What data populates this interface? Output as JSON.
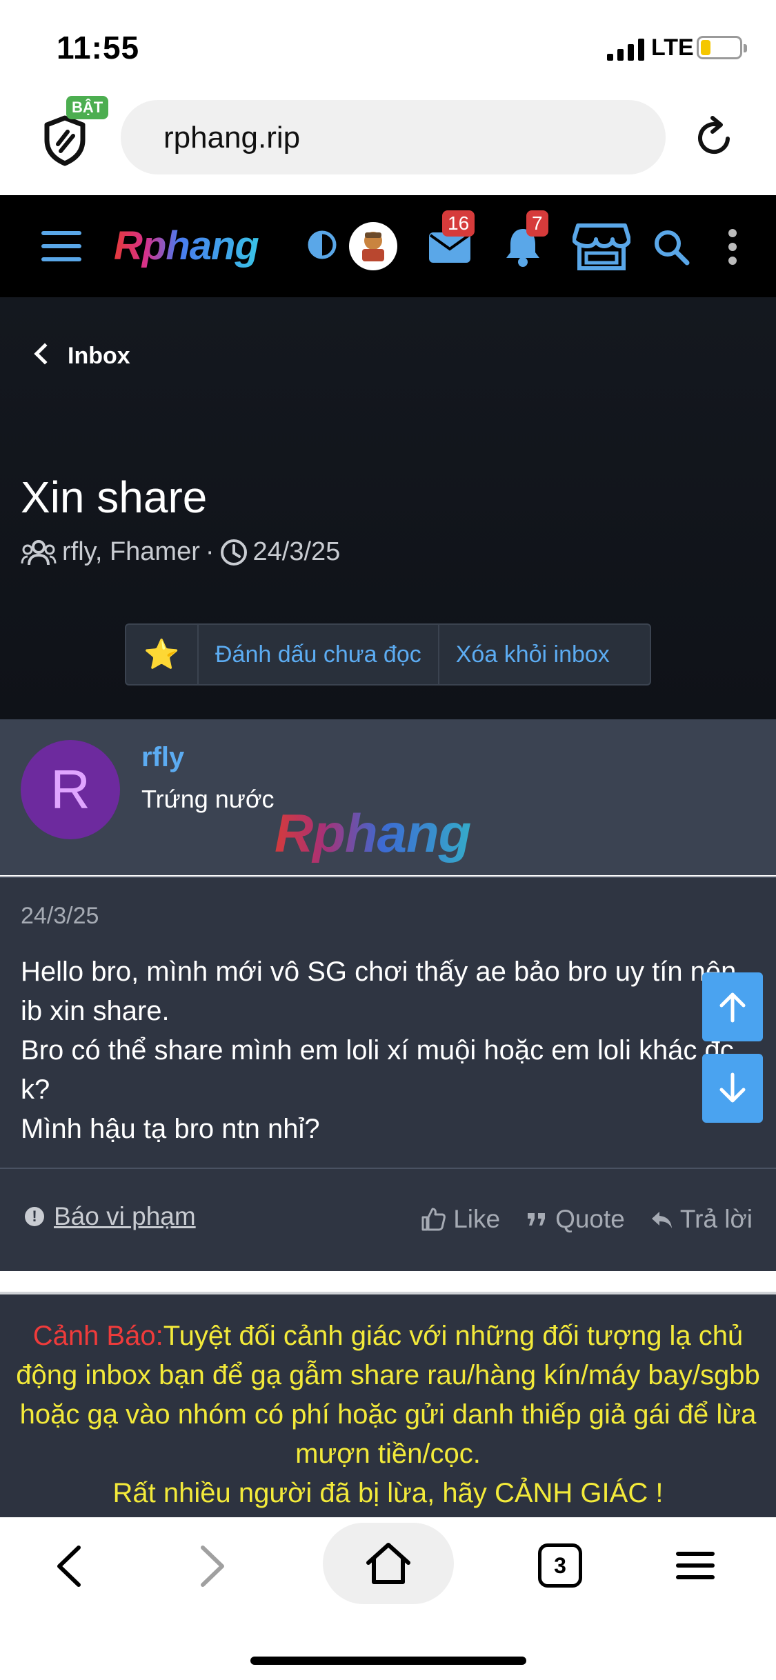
{
  "status_bar": {
    "time": "11:55",
    "network": "LTE"
  },
  "browser": {
    "shield_badge": "BẬT",
    "url": "rphang.rip",
    "tab_count": "3"
  },
  "site_header": {
    "logo": "Rphang",
    "messages_badge": "16",
    "alerts_badge": "7"
  },
  "conversation": {
    "back_label": "Inbox",
    "title": "Xin share",
    "participants": "rfly, Fhamer",
    "date": "24/3/25",
    "actions": {
      "star": "⭐",
      "mark_unread": "Đánh dấu chưa đọc",
      "delete": "Xóa khỏi inbox"
    }
  },
  "message": {
    "avatar_letter": "R",
    "username": "rfly",
    "user_title": "Trứng nước",
    "watermark": "Rphang",
    "date": "24/3/25",
    "text": "Hello bro, mình mới vô SG chơi thấy ae bảo bro uy tín nên ib xin share.\nBro có thể share mình em loli xí muội hoặc em loli khác đc k?\nMình hậu tạ bro ntn nhỉ?",
    "report_label": "Báo vi phạm",
    "like_label": "Like",
    "quote_label": "Quote",
    "reply_label": "Trả lời"
  },
  "warning": {
    "prefix": "Cảnh Báo:",
    "text": "Tuyệt đối cảnh giác với những đối tượng lạ chủ động inbox bạn để gạ gẫm share rau/hàng kín/máy bay/sgbb hoặc gạ vào nhóm có phí hoặc gửi danh thiếp giả gái để lừa mượn tiền/cọc.",
    "line2": "Rất nhiều người đã bị lừa, hãy CẢNH GIÁC !"
  },
  "colors": {
    "accent": "#5cacf2",
    "warning_text": "#f3ea3a",
    "warning_prefix": "#ef3b3b",
    "badge": "#d63b3b"
  }
}
